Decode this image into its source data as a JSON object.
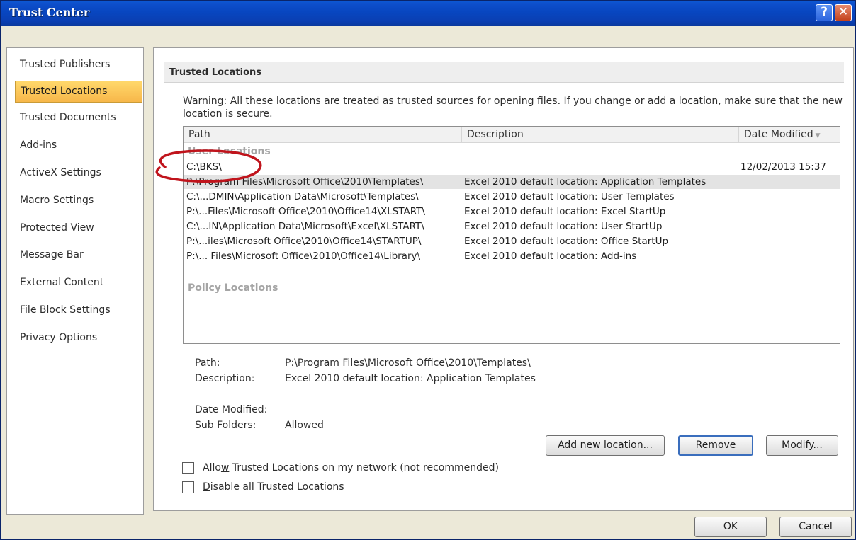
{
  "window": {
    "title": "Trust Center"
  },
  "titlebar": {
    "help_icon": "?",
    "close_icon": "✕"
  },
  "sidebar": {
    "items": [
      {
        "label": "Trusted Publishers"
      },
      {
        "label": "Trusted Locations",
        "selected": true
      },
      {
        "label": "Trusted Documents"
      },
      {
        "label": "Add-ins"
      },
      {
        "label": "ActiveX Settings"
      },
      {
        "label": "Macro Settings"
      },
      {
        "label": "Protected View"
      },
      {
        "label": "Message Bar"
      },
      {
        "label": "External Content"
      },
      {
        "label": "File Block Settings"
      },
      {
        "label": "Privacy Options"
      }
    ]
  },
  "main": {
    "section_title": "Trusted Locations",
    "warning": "Warning: All these locations are treated as trusted sources for opening files.  If you change or add a location, make sure that the new location is secure.",
    "table": {
      "columns": {
        "path": "Path",
        "description": "Description",
        "date_modified": "Date Modified"
      },
      "user_group_label": "User Locations",
      "rows": [
        {
          "path": "C:\\BKS\\",
          "description": "",
          "date": "12/02/2013 15:37"
        },
        {
          "path": "P:\\Program Files\\Microsoft Office\\2010\\Templates\\",
          "description": "Excel 2010 default location: Application Templates",
          "date": "",
          "selected": true
        },
        {
          "path": "C:\\...DMIN\\Application Data\\Microsoft\\Templates\\",
          "description": "Excel 2010 default location: User Templates",
          "date": ""
        },
        {
          "path": "P:\\...Files\\Microsoft Office\\2010\\Office14\\XLSTART\\",
          "description": "Excel 2010 default location: Excel StartUp",
          "date": ""
        },
        {
          "path": "C:\\...IN\\Application Data\\Microsoft\\Excel\\XLSTART\\",
          "description": "Excel 2010 default location: User StartUp",
          "date": ""
        },
        {
          "path": "P:\\...iles\\Microsoft Office\\2010\\Office14\\STARTUP\\",
          "description": "Excel 2010 default location: Office StartUp",
          "date": ""
        },
        {
          "path": "P:\\... Files\\Microsoft Office\\2010\\Office14\\Library\\",
          "description": "Excel 2010 default location: Add-ins",
          "date": ""
        }
      ],
      "policy_group_label": "Policy Locations"
    },
    "details": {
      "path_label": "Path:",
      "path_value": "P:\\Program Files\\Microsoft Office\\2010\\Templates\\",
      "description_label": "Description:",
      "description_value": "Excel 2010 default location: Application Templates",
      "date_label": "Date Modified:",
      "subfolders_label": "Sub Folders:",
      "subfolders_value": "Allowed"
    },
    "buttons": {
      "add_new_pre": "",
      "add_new_key": "A",
      "add_new_post": "dd new location...",
      "remove_pre": "",
      "remove_key": "R",
      "remove_post": "emove",
      "modify_pre": "",
      "modify_key": "M",
      "modify_post": "odify..."
    },
    "options": {
      "allow_network_pre": "Allo",
      "allow_network_key": "w",
      "allow_network_post": " Trusted Locations on my network (not recommended)",
      "allow_network_checked": false,
      "disable_all_pre": "",
      "disable_all_key": "D",
      "disable_all_post": "isable all Trusted Locations",
      "disable_all_checked": false
    }
  },
  "footer": {
    "ok_label": "OK",
    "cancel_label": "Cancel"
  },
  "annotation": {
    "color": "#c0141c"
  }
}
